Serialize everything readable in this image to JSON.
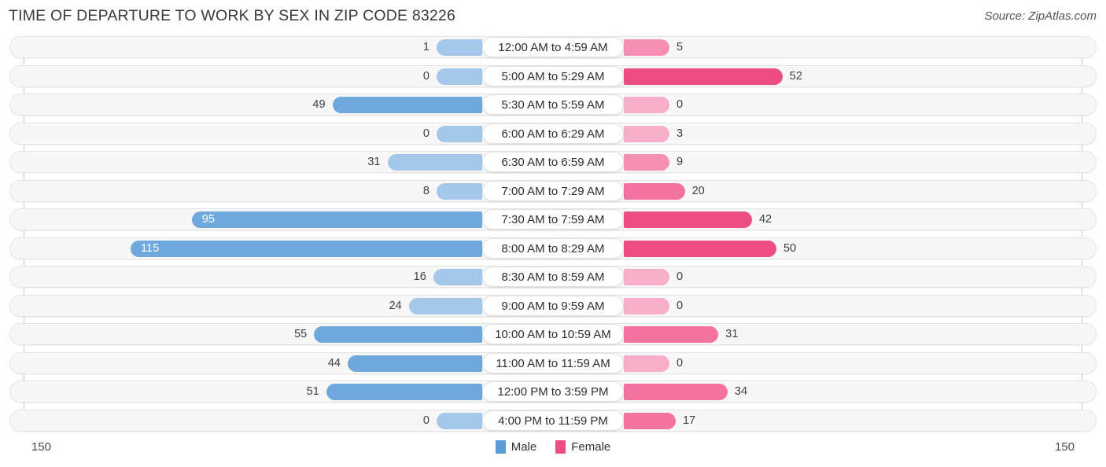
{
  "header": {
    "title": "TIME OF DEPARTURE TO WORK BY SEX IN ZIP CODE 83226",
    "source": "Source: ZipAtlas.com"
  },
  "legend": {
    "male_label": "Male",
    "female_label": "Female",
    "male_color": "#5b9bd5",
    "female_color": "#ec4d82"
  },
  "axis": {
    "left_max": "150",
    "right_max": "150"
  },
  "chart_data": {
    "type": "bar",
    "orientation": "horizontal-diverging",
    "title": "TIME OF DEPARTURE TO WORK BY SEX IN ZIP CODE 83226",
    "xlabel": "",
    "ylabel": "",
    "xlim": [
      150,
      150
    ],
    "grid": false,
    "legend_position": "bottom-center",
    "categories": [
      "12:00 AM to 4:59 AM",
      "5:00 AM to 5:29 AM",
      "5:30 AM to 5:59 AM",
      "6:00 AM to 6:29 AM",
      "6:30 AM to 6:59 AM",
      "7:00 AM to 7:29 AM",
      "7:30 AM to 7:59 AM",
      "8:00 AM to 8:29 AM",
      "8:30 AM to 8:59 AM",
      "9:00 AM to 9:59 AM",
      "10:00 AM to 10:59 AM",
      "11:00 AM to 11:59 AM",
      "12:00 PM to 3:59 PM",
      "4:00 PM to 11:59 PM"
    ],
    "series": [
      {
        "name": "Male",
        "color": "#5b9bd5",
        "values": [
          1,
          0,
          49,
          0,
          31,
          8,
          95,
          115,
          16,
          24,
          55,
          44,
          51,
          0
        ]
      },
      {
        "name": "Female",
        "color": "#ec4d82",
        "values": [
          5,
          52,
          0,
          3,
          9,
          20,
          42,
          50,
          0,
          0,
          31,
          0,
          34,
          17
        ]
      }
    ]
  },
  "rows": [
    {
      "label": "12:00 AM to 4:59 AM",
      "male": "1",
      "female": "5"
    },
    {
      "label": "5:00 AM to 5:29 AM",
      "male": "0",
      "female": "52"
    },
    {
      "label": "5:30 AM to 5:59 AM",
      "male": "49",
      "female": "0"
    },
    {
      "label": "6:00 AM to 6:29 AM",
      "male": "0",
      "female": "3"
    },
    {
      "label": "6:30 AM to 6:59 AM",
      "male": "31",
      "female": "9"
    },
    {
      "label": "7:00 AM to 7:29 AM",
      "male": "8",
      "female": "20"
    },
    {
      "label": "7:30 AM to 7:59 AM",
      "male": "95",
      "female": "42"
    },
    {
      "label": "8:00 AM to 8:29 AM",
      "male": "115",
      "female": "50"
    },
    {
      "label": "8:30 AM to 8:59 AM",
      "male": "16",
      "female": "0"
    },
    {
      "label": "9:00 AM to 9:59 AM",
      "male": "24",
      "female": "0"
    },
    {
      "label": "10:00 AM to 10:59 AM",
      "male": "55",
      "female": "31"
    },
    {
      "label": "11:00 AM to 11:59 AM",
      "male": "44",
      "female": "0"
    },
    {
      "label": "12:00 PM to 3:59 PM",
      "male": "51",
      "female": "34"
    },
    {
      "label": "4:00 PM to 11:59 PM",
      "male": "0",
      "female": "17"
    }
  ]
}
